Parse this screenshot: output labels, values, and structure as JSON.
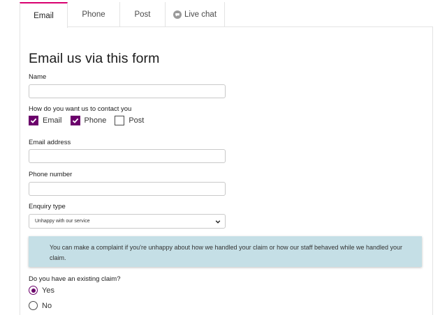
{
  "tabs": [
    {
      "label": "Email",
      "active": true
    },
    {
      "label": "Phone",
      "active": false
    },
    {
      "label": "Post",
      "active": false
    },
    {
      "label": "Live chat",
      "active": false,
      "icon": "chat-bubble-icon"
    }
  ],
  "form": {
    "title": "Email us via this form",
    "name_label": "Name",
    "name_value": "",
    "contact_label": "How do you want us to contact you",
    "contact_options": [
      {
        "label": "Email",
        "checked": true
      },
      {
        "label": "Phone",
        "checked": true
      },
      {
        "label": "Post",
        "checked": false
      }
    ],
    "email_label": "Email address",
    "email_value": "",
    "phone_label": "Phone number",
    "phone_value": "",
    "enquiry_label": "Enquiry type",
    "enquiry_value": "Unhappy with our service",
    "info_text": "You can make a complaint if you're unhappy about how we handled your claim or how our staff behaved while we handled your claim.",
    "claim_label": "Do you have an existing claim?",
    "claim_options": [
      {
        "label": "Yes",
        "checked": true
      },
      {
        "label": "No",
        "checked": false
      }
    ]
  },
  "colors": {
    "accent": "#6b006b",
    "active_tab_border": "#d8006f",
    "info_background": "#c5dfe6"
  }
}
